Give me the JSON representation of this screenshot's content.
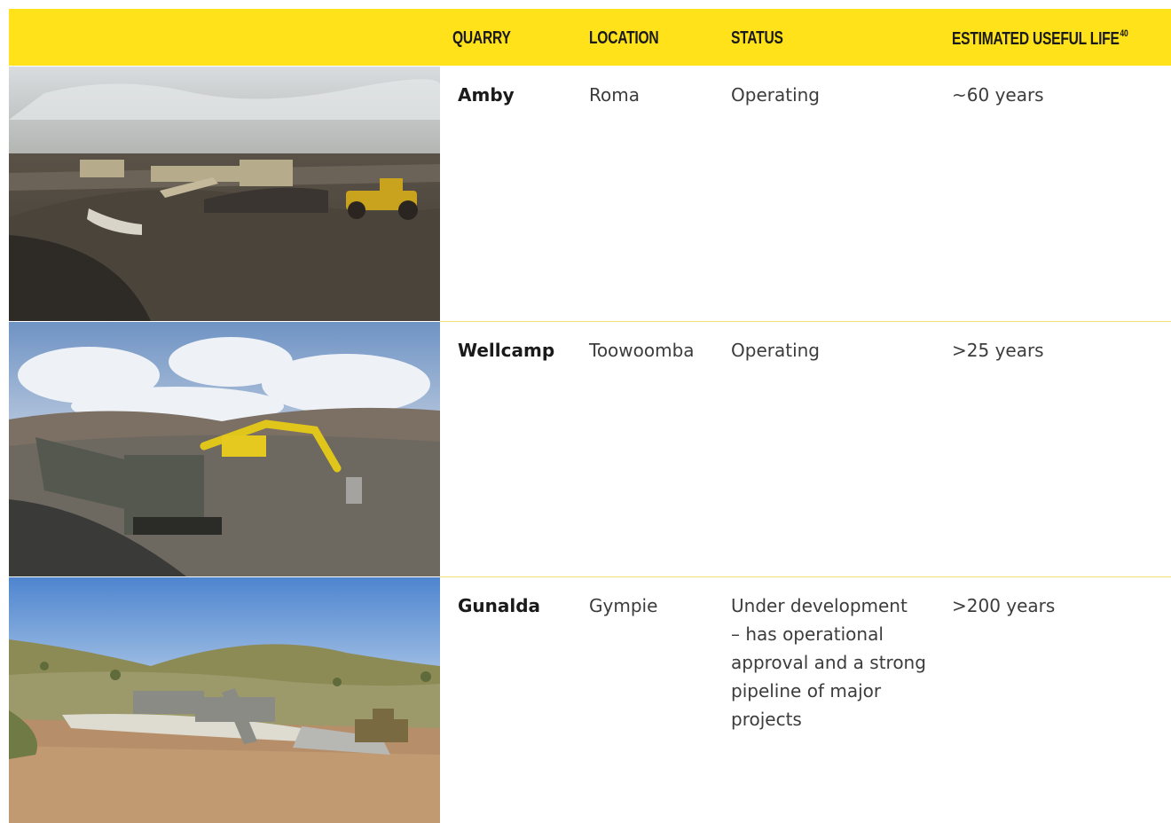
{
  "table": {
    "headers": {
      "quarry": "QUARRY",
      "location": "LOCATION",
      "status": "STATUS",
      "life": "ESTIMATED USEFUL LIFE",
      "life_footnote": "40"
    },
    "rows": [
      {
        "quarry": "Amby",
        "location": "Roma",
        "status": "Operating",
        "life": "~60 years"
      },
      {
        "quarry": "Wellcamp",
        "location": "Toowoomba",
        "status": "Operating",
        "life": ">25 years"
      },
      {
        "quarry": "Gunalda",
        "location": "Gympie",
        "status_lines": [
          "Under development",
          "– has operational",
          "approval and a strong",
          "pipeline of major",
          "projects"
        ],
        "life": ">200 years"
      }
    ]
  },
  "colors": {
    "header_bg": "#ffe21a",
    "divider": "#f0e07a"
  }
}
